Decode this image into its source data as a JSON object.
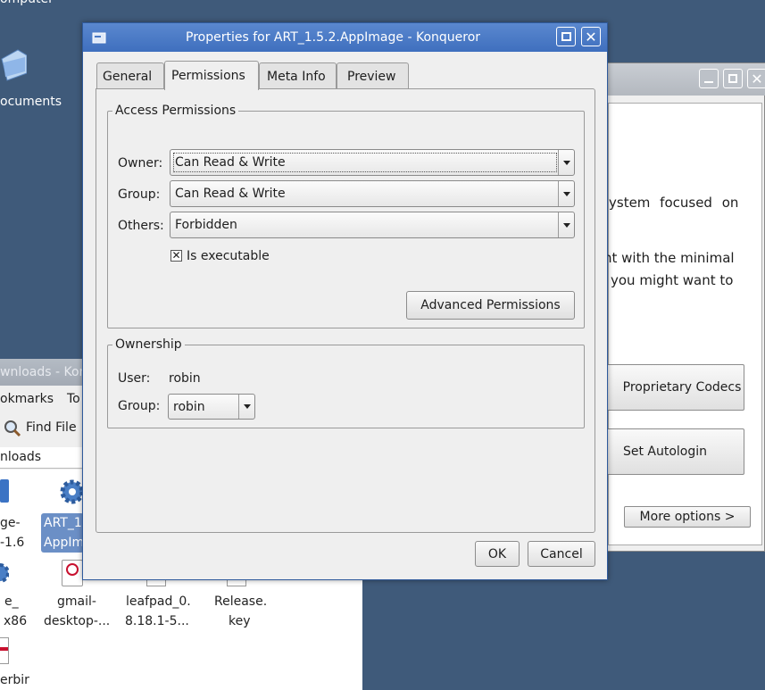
{
  "desktop": {
    "computer_label": "omputer",
    "documents_label": "ocuments"
  },
  "bg_window": {
    "lines": [
      "ystem focused on",
      "nt with the minimal",
      "you might want to"
    ],
    "proprietary_codecs": "Proprietary Codecs",
    "set_autologin": "Set Autologin",
    "more_options": "More options  >"
  },
  "file_manager": {
    "title": "wnloads - Kon",
    "menu_bookmarks": "okmarks",
    "menu_tools": "To",
    "find_file": "Find File",
    "location": "nloads",
    "files": [
      {
        "l1": "ge-",
        "l2": "-1.6"
      },
      {
        "l1": "ART_1",
        "l2": "AppIm"
      },
      {
        "l1": "e_",
        "l2": "x86"
      },
      {
        "l1": "gmail-",
        "l2": "desktop-..."
      },
      {
        "l1": "leafpad_0.",
        "l2": "8.18.1-5..."
      },
      {
        "l1": "Release.",
        "l2": "key"
      },
      {
        "l1": "erbir",
        "l2": ""
      }
    ]
  },
  "dialog": {
    "title": "Properties for ART_1.5.2.AppImage - Konqueror",
    "tabs": [
      "General",
      "Permissions",
      "Meta Info",
      "Preview"
    ],
    "access_group": "Access Permissions",
    "owner_label": "Owner:",
    "owner_value": "Can Read & Write",
    "group_label": "Group:",
    "group_value": "Can Read & Write",
    "others_label": "Others:",
    "others_value": "Forbidden",
    "executable_label": "Is executable",
    "advanced_button": "Advanced Permissions",
    "ownership_group": "Ownership",
    "user_label": "User:",
    "user_value": "robin",
    "own_group_label": "Group:",
    "own_group_value": "robin",
    "ok_button": "OK",
    "cancel_button": "Cancel"
  },
  "colors": {
    "desktop": "#3f5a7a",
    "titlebar": "#4a79c4",
    "selection": "#6b8fc6"
  }
}
